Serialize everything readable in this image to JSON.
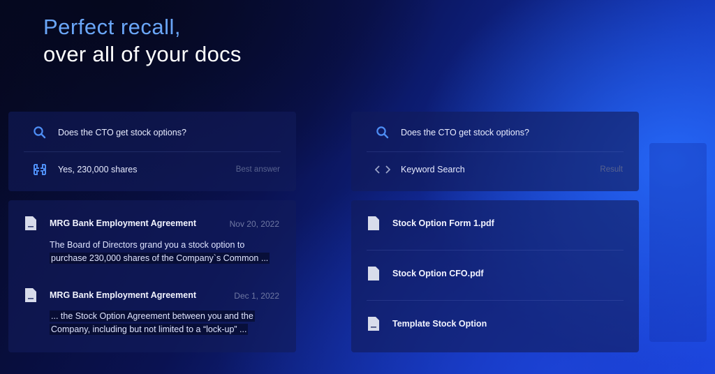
{
  "headline": {
    "line1": "Perfect recall,",
    "line2": "over all of your docs"
  },
  "left": {
    "query": "Does the CTO get stock options?",
    "answer": "Yes, 230,000 shares",
    "answer_meta": "Best answer",
    "icons": {
      "search": "search-icon",
      "brand": "brand-logo-icon",
      "document": "document-icon"
    },
    "results": [
      {
        "title": "MRG Bank Employment Agreement",
        "date": "Nov 20, 2022",
        "snippet_line1": "The Board of Directors grand you a stock option to",
        "snippet_line2": "purchase 230,000 shares of the Company`s Common ..."
      },
      {
        "title": "MRG Bank Employment Agreement",
        "date": "Dec 1, 2022",
        "snippet_line1": "... the Stock Option Agreement between you and the",
        "snippet_line2": "Company, including but not limited to a “lock-up” ..."
      }
    ]
  },
  "right": {
    "query": "Does the CTO get stock options?",
    "mode": "Keyword Search",
    "mode_meta": "Result",
    "icons": {
      "search": "search-icon",
      "code": "code-brackets-icon",
      "document": "document-icon"
    },
    "files": [
      {
        "name": "Stock Option Form 1.pdf"
      },
      {
        "name": "Stock Option CFO.pdf"
      },
      {
        "name": "Template Stock Option"
      }
    ]
  },
  "colors": {
    "accent_blue": "#6aa6f8",
    "panel_bg": "#121c5a",
    "muted_text": "#59638f"
  }
}
